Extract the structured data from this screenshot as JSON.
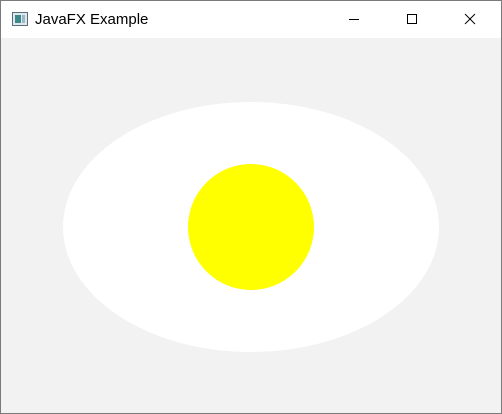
{
  "window": {
    "title": "JavaFX Example",
    "icon": "java-app-icon",
    "controls": {
      "minimize_icon": "minimize-icon",
      "maximize_icon": "maximize-icon",
      "close_icon": "close-icon"
    }
  },
  "scene": {
    "background_color": "#f2f2f2",
    "ellipse_fill": "#ffffff",
    "circle_fill": "#ffff00"
  }
}
